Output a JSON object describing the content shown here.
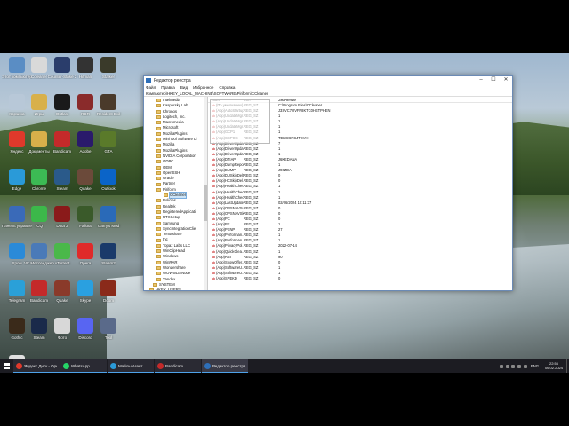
{
  "desktop": {
    "icons": [
      {
        "label": "Этот компьютер",
        "icon": "computer-icon",
        "color": "#5a8dc4"
      },
      {
        "label": "Ccleaner",
        "icon": "ccleaner-icon",
        "color": "#d9d9d9"
      },
      {
        "label": "Counter-Strike 2",
        "icon": "cs2-icon",
        "color": "#2a3d6b"
      },
      {
        "label": "Hitman",
        "icon": "hitman-icon",
        "color": "#333333"
      },
      {
        "label": "Stalker",
        "icon": "stalker-icon",
        "color": "#3a3a2a"
      },
      {
        "label": "Корзина",
        "icon": "recycle-bin-icon",
        "color": "#b8c8d8"
      },
      {
        "label": "Игры",
        "icon": "games-folder-icon",
        "color": "#d8b04a"
      },
      {
        "label": "Outlast",
        "icon": "outlast-icon",
        "color": "#1a1a1a"
      },
      {
        "label": "RDR",
        "icon": "rdr-icon",
        "color": "#8a2b2b"
      },
      {
        "label": "Resident Evil",
        "icon": "re-icon",
        "color": "#4a3a2a"
      },
      {
        "label": "Яндекс",
        "icon": "yandex-icon",
        "color": "#e0392b"
      },
      {
        "label": "Документы",
        "icon": "docs-icon",
        "color": "#d8b04a"
      },
      {
        "label": "Bandicam",
        "icon": "bandicam-icon",
        "color": "#c42a2a"
      },
      {
        "label": "Adobe",
        "icon": "adobe-icon",
        "color": "#2a1a6b"
      },
      {
        "label": "GTA",
        "icon": "gta-icon",
        "color": "#5a7a2a"
      },
      {
        "label": "Edge",
        "icon": "edge-icon",
        "color": "#2a9ad8"
      },
      {
        "label": "Chrome",
        "icon": "chrome-icon",
        "color": "#3cba54"
      },
      {
        "label": "Steam",
        "icon": "steam-icon",
        "color": "#2a5a8a"
      },
      {
        "label": "Quake",
        "icon": "quake-icon",
        "color": "#6b4a3a"
      },
      {
        "label": "Outlook",
        "icon": "outlook-icon",
        "color": "#0a64c8"
      },
      {
        "label": "Панель управления",
        "icon": "control-panel-icon",
        "color": "#3a6ab8"
      },
      {
        "label": "ICQ",
        "icon": "icq-icon",
        "color": "#3cb84a"
      },
      {
        "label": "Dota 2",
        "icon": "dota-icon",
        "color": "#8a1a1a"
      },
      {
        "label": "Fallout",
        "icon": "fallout-icon",
        "color": "#3a5a2a"
      },
      {
        "label": "Garry's Mod",
        "icon": "gmod-icon",
        "color": "#2a6ab8"
      },
      {
        "label": "Хром",
        "icon": "chrome-blue-icon",
        "color": "#2a8ad8"
      },
      {
        "label": "VK Мессенджер",
        "icon": "vk-icon",
        "color": "#4a7ab8"
      },
      {
        "label": "uTorrent",
        "icon": "utorrent-icon",
        "color": "#4ab84a"
      },
      {
        "label": "Opera",
        "icon": "opera-icon",
        "color": "#e02a2a"
      },
      {
        "label": "Steam2",
        "icon": "steam2-icon",
        "color": "#1a3a6a"
      },
      {
        "label": "Telegram",
        "icon": "telegram-icon",
        "color": "#2aa0d8"
      },
      {
        "label": "Bandicam",
        "icon": "bandicam2-icon",
        "color": "#c42a2a"
      },
      {
        "label": "Quake",
        "icon": "quake2-icon",
        "color": "#8a3a2a"
      },
      {
        "label": "Skype",
        "icon": "skype-icon",
        "color": "#2aa0e0"
      },
      {
        "label": "Doom",
        "icon": "doom-icon",
        "color": "#8a2a1a"
      },
      {
        "label": "Gothic",
        "icon": "gothic-icon",
        "color": "#3a2a1a"
      },
      {
        "label": "Steam",
        "icon": "steam3-icon",
        "color": "#1a2a4a"
      },
      {
        "label": "Фото",
        "icon": "photos-icon",
        "color": "#d8d8d8"
      },
      {
        "label": "Discord",
        "icon": "discord-icon",
        "color": "#5865f2"
      },
      {
        "label": "Tool",
        "icon": "tool-icon",
        "color": "#5a6a8a"
      },
      {
        "label": "Roblox",
        "icon": "roblox-icon",
        "color": "#e0e0e0"
      }
    ]
  },
  "regedit": {
    "title": "Редактор реестра",
    "menu": [
      "Файл",
      "Правка",
      "Вид",
      "Избранное",
      "Справка"
    ],
    "address": "Компьютер\\HKEY_LOCAL_MACHINE\\SOFTWARE\\Piriform\\CCleaner",
    "tree": [
      {
        "label": "IntelMedia",
        "selected": false
      },
      {
        "label": "Kaspersky Lab",
        "selected": false
      },
      {
        "label": "Khronos",
        "selected": false
      },
      {
        "label": "Logitech, Inc.",
        "selected": false
      },
      {
        "label": "Macromedia",
        "selected": false
      },
      {
        "label": "Microsoft",
        "selected": false
      },
      {
        "label": "MozillaPlugins",
        "selected": false
      },
      {
        "label": "MiniTool Software Li",
        "selected": false
      },
      {
        "label": "Mozilla",
        "selected": false
      },
      {
        "label": "MozillaPlugins",
        "selected": false
      },
      {
        "label": "NVIDIA Corporation",
        "selected": false
      },
      {
        "label": "ODBC",
        "selected": false
      },
      {
        "label": "OEM",
        "selected": false
      },
      {
        "label": "OpenSSH",
        "selected": false
      },
      {
        "label": "Oracle",
        "selected": false
      },
      {
        "label": "Partner",
        "selected": false
      },
      {
        "label": "Piriform",
        "selected": false
      },
      {
        "label": "CCleaner",
        "selected": true
      },
      {
        "label": "Policies",
        "selected": false
      },
      {
        "label": "Realtek",
        "selected": false
      },
      {
        "label": "RegisteredApplicati",
        "selected": false
      },
      {
        "label": "RTKSetup",
        "selected": false
      },
      {
        "label": "Samsung",
        "selected": false
      },
      {
        "label": "SyncIntegrationClie",
        "selected": false
      },
      {
        "label": "Tenorshare",
        "selected": false
      },
      {
        "label": "tnc",
        "selected": false
      },
      {
        "label": "Topaz Labs LLC",
        "selected": false
      },
      {
        "label": "WinClipHead",
        "selected": false
      },
      {
        "label": "Windows",
        "selected": false
      },
      {
        "label": "WinRAR",
        "selected": false
      },
      {
        "label": "Wondershare",
        "selected": false
      },
      {
        "label": "WOW6432Node",
        "selected": false
      },
      {
        "label": "Yandex",
        "selected": false
      },
      {
        "label": "SYSTEM",
        "selected": false
      },
      {
        "label": "HKEY_USERS",
        "selected": false
      },
      {
        "label": "HKEY_CURRENT_CONFIG",
        "selected": false
      }
    ],
    "columns": {
      "name": "Имя",
      "type": "Тип",
      "data": "Значение"
    },
    "values": [
      {
        "name": "(По умолчанию)",
        "type": "REG_SZ",
        "data": "C:\\Program Files\\CCleaner"
      },
      {
        "name": "(App)AutoStartup...",
        "type": "REG_SZ",
        "data": "J3SVC7OVFP8KTC0HSTPHEN"
      },
      {
        "name": "(App)UpdateMgr...",
        "type": "REG_SZ",
        "data": "1"
      },
      {
        "name": "(App)UpdateMgr...",
        "type": "REG_SZ",
        "data": "1"
      },
      {
        "name": "(App)UpdateMgr...",
        "type": "REG_SZ",
        "data": "1"
      },
      {
        "name": "(App)GCP1",
        "type": "REG_SZ",
        "data": "1"
      },
      {
        "name": "(App)CCPOC",
        "type": "REG_SZ",
        "data": "TEKGGRCJTCVH"
      },
      {
        "name": "(App)DriverUpda...",
        "type": "REG_SZ",
        "data": "7"
      },
      {
        "name": "(App)DriverUpda...",
        "type": "REG_SZ",
        "data": "1"
      },
      {
        "name": "(App)DriverUpda...",
        "type": "REG_SZ",
        "data": "1"
      },
      {
        "name": "(App)DTIAP",
        "type": "REG_SZ",
        "data": "J6KEDANA"
      },
      {
        "name": "(App)DumpReportAp...",
        "type": "REG_SZ",
        "data": "1"
      },
      {
        "name": "(App)DUMP",
        "type": "REG_SZ",
        "data": "J96ZDA"
      },
      {
        "name": "(App)DUSkipDelta...",
        "type": "REG_SZ",
        "data": "0"
      },
      {
        "name": "(App)HCSkipDel...",
        "type": "REG_SZ",
        "data": "0"
      },
      {
        "name": "(App)HealthChec...",
        "type": "REG_SZ",
        "data": "1"
      },
      {
        "name": "(App)HealthChec...",
        "type": "REG_SZ",
        "data": "1"
      },
      {
        "name": "(App)HealthChec...",
        "type": "REG_SZ",
        "data": "1"
      },
      {
        "name": "(App)LastUpdate",
        "type": "REG_SZ",
        "data": "02/06/2024 10:11:37"
      },
      {
        "name": "(App)OPSNAVSu...",
        "type": "REG_SZ",
        "data": "0"
      },
      {
        "name": "(App)OPSNAVSk...",
        "type": "REG_SZ",
        "data": "0"
      },
      {
        "name": "(App)PC",
        "type": "REG_SZ",
        "data": "0"
      },
      {
        "name": "(App)PE",
        "type": "REG_SZ",
        "data": "1"
      },
      {
        "name": "(App)PENP",
        "type": "REG_SZ",
        "data": "27"
      },
      {
        "name": "(App)Performan...",
        "type": "REG_SZ",
        "data": "1"
      },
      {
        "name": "(App)Performan...",
        "type": "REG_SZ",
        "data": "1"
      },
      {
        "name": "(App)PrivacyPol...",
        "type": "REG_SZ",
        "data": "2022-07-14"
      },
      {
        "name": "(App)QuickClea...",
        "type": "REG_SZ",
        "data": "1"
      },
      {
        "name": "(App)RBI",
        "type": "REG_SZ",
        "data": "90"
      },
      {
        "name": "(App)ShowOffer...",
        "type": "REG_SZ",
        "data": "0"
      },
      {
        "name": "(App)SoftwareU...",
        "type": "REG_SZ",
        "data": "1"
      },
      {
        "name": "(App)SoftwareU...",
        "type": "REG_SZ",
        "data": "1"
      },
      {
        "name": "(App)SPEKD",
        "type": "REG_SZ",
        "data": "0"
      }
    ]
  },
  "taskbar": {
    "apps": [
      {
        "label": "Яндекс Диск - Opera",
        "icon": "opera-icon",
        "color": "#e0392b"
      },
      {
        "label": "WhatsApp",
        "icon": "whatsapp-icon",
        "color": "#25d366"
      },
      {
        "label": "Майлы Агент",
        "icon": "mail-agent-icon",
        "color": "#2a9ad8"
      },
      {
        "label": "Bandicam",
        "icon": "bandicam-icon",
        "color": "#c42a2a"
      },
      {
        "label": "Редактор реестра",
        "icon": "regedit-icon",
        "color": "#2e6fb8"
      }
    ],
    "lang": "ENG",
    "time": "22:56",
    "date": "06.02.2024"
  }
}
